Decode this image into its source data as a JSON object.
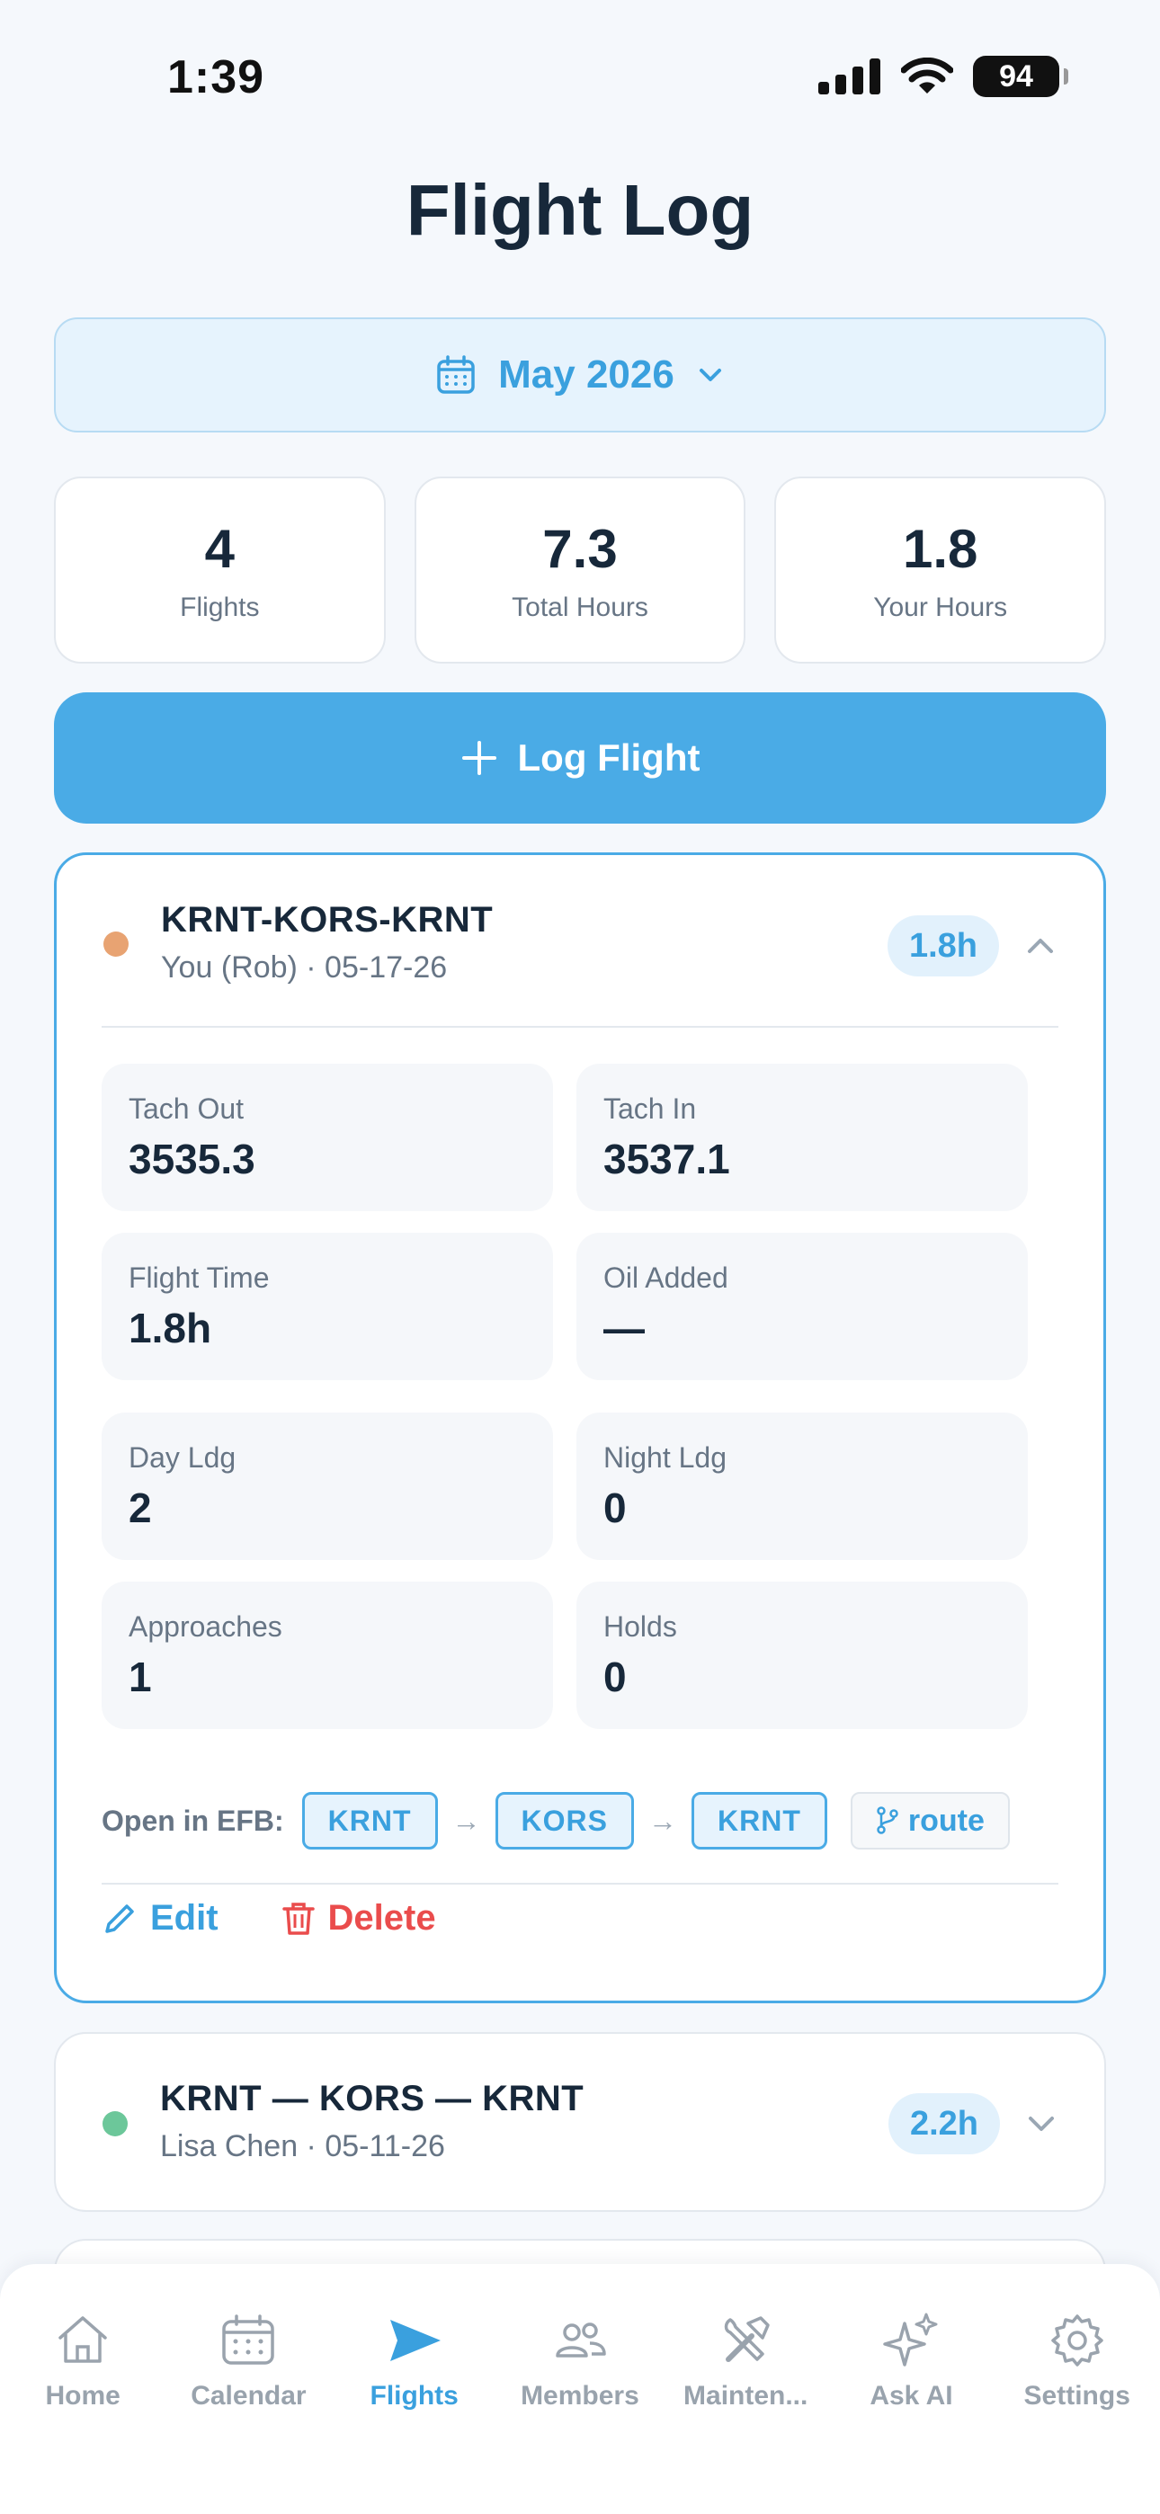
{
  "status": {
    "time": "1:39",
    "battery": "94"
  },
  "title": "Flight Log",
  "month_picker": {
    "label": "May 2026"
  },
  "stats": [
    {
      "value": "4",
      "label": "Flights"
    },
    {
      "value": "7.3",
      "label": "Total Hours"
    },
    {
      "value": "1.8",
      "label": "Your Hours"
    }
  ],
  "log_button": {
    "label": "Log Flight"
  },
  "flights": [
    {
      "route": "KRNT-KORS-KRNT",
      "subtitle": "You (Rob) · 05-17-26",
      "hours": "1.8h",
      "dot_color": "#e8a372",
      "expanded": true,
      "details": [
        {
          "label": "Tach Out",
          "value": "3535.3"
        },
        {
          "label": "Tach In",
          "value": "3537.1"
        },
        {
          "label": "Flight Time",
          "value": "1.8h"
        },
        {
          "label": "Oil Added",
          "value": "—"
        },
        {
          "label": "Day Ldg",
          "value": "2"
        },
        {
          "label": "Night Ldg",
          "value": "0"
        },
        {
          "label": "Approaches",
          "value": "1"
        },
        {
          "label": "Holds",
          "value": "0"
        }
      ],
      "efb": {
        "label": "Open in EFB:",
        "airports": [
          "KRNT",
          "KORS",
          "KRNT"
        ],
        "arrow": "→",
        "route_label": "route"
      },
      "actions": {
        "edit": "Edit",
        "delete": "Delete"
      }
    },
    {
      "route": "KRNT — KORS — KRNT",
      "subtitle": "Lisa Chen · 05-11-26",
      "hours": "2.2h",
      "dot_color": "#6cc79a",
      "expanded": false
    }
  ],
  "tabs": [
    {
      "label": "Home",
      "icon": "home-icon",
      "active": false
    },
    {
      "label": "Calendar",
      "icon": "calendar-icon",
      "active": false
    },
    {
      "label": "Flights",
      "icon": "paper-plane-icon",
      "active": true
    },
    {
      "label": "Members",
      "icon": "members-icon",
      "active": false
    },
    {
      "label": "Mainten...",
      "icon": "tools-icon",
      "active": false
    },
    {
      "label": "Ask AI",
      "icon": "sparkles-icon",
      "active": false
    },
    {
      "label": "Settings",
      "icon": "gear-icon",
      "active": false
    }
  ],
  "colors": {
    "accent": "#4aabe6",
    "danger": "#ea4c4c",
    "text": "#17283a",
    "muted": "#677585"
  }
}
